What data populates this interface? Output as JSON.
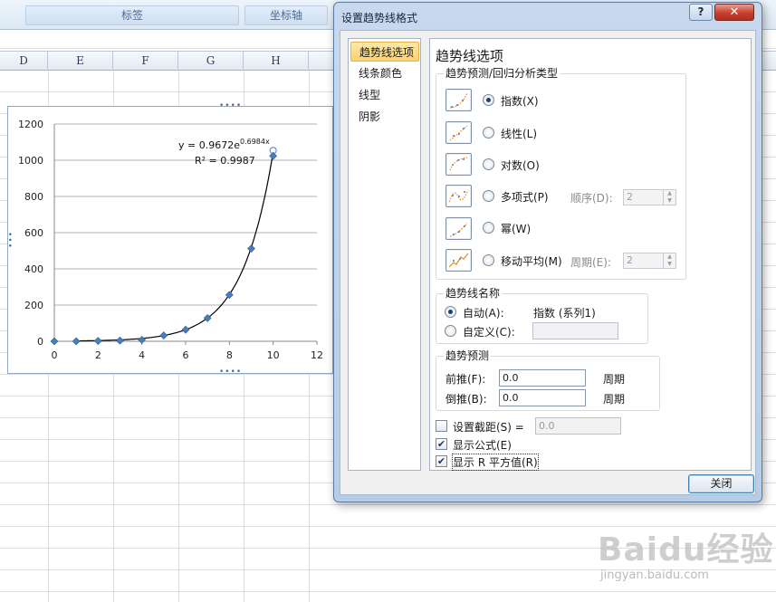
{
  "ribbon": {
    "labels_group": "标签",
    "axes_group": "坐标轴"
  },
  "columns": [
    "D",
    "E",
    "F",
    "G",
    "H"
  ],
  "chart_data": {
    "type": "scatter",
    "x": [
      0,
      1,
      2,
      3,
      4,
      5,
      6,
      7,
      8,
      9,
      10
    ],
    "series": [
      {
        "values": [
          0,
          0,
          2,
          4,
          8,
          32,
          64,
          128,
          256,
          512,
          1024
        ]
      }
    ],
    "trendline": {
      "type": "exponential",
      "a": 0.9672,
      "b": 0.6984,
      "equation_prefix": "y = 0.9672e",
      "equation_exponent": "0.6984x",
      "r2_label": "R² = 0.9987"
    },
    "xlim": [
      0,
      12
    ],
    "ylim": [
      0,
      1200
    ],
    "x_ticks": [
      "0",
      "2",
      "4",
      "6",
      "8",
      "10",
      "12"
    ],
    "y_ticks": [
      "0",
      "200",
      "400",
      "600",
      "800",
      "1000",
      "1200"
    ],
    "grid": true,
    "colors": {
      "marker": "#4a7ebb",
      "trend": "#000000",
      "grid": "#b0b0b0"
    }
  },
  "dialog": {
    "title": "设置趋势线格式",
    "help": "?",
    "close_x": "✕",
    "nav": [
      "趋势线选项",
      "线条颜色",
      "线型",
      "阴影"
    ],
    "section_title": "趋势线选项",
    "regression_group": "趋势预测/回归分析类型",
    "types": [
      {
        "label": "指数(X)",
        "icon": "exponential-trend-icon"
      },
      {
        "label": "线性(L)",
        "icon": "linear-trend-icon"
      },
      {
        "label": "对数(O)",
        "icon": "logarithmic-trend-icon"
      },
      {
        "label": "多项式(P)",
        "icon": "polynomial-trend-icon"
      },
      {
        "label": "幂(W)",
        "icon": "power-trend-icon"
      },
      {
        "label": "移动平均(M)",
        "icon": "moving-average-trend-icon"
      }
    ],
    "order_label": "顺序(D):",
    "order_value": "2",
    "period_label": "周期(E):",
    "period_value": "2",
    "name_group": "趋势线名称",
    "auto_label": "自动(A):",
    "auto_value": "指数 (系列1)",
    "custom_label": "自定义(C):",
    "custom_value": "",
    "forecast_group": "趋势预测",
    "forward_label": "前推(F):",
    "forward_value": "0.0",
    "forward_unit": "周期",
    "backward_label": "倒推(B):",
    "backward_value": "0.0",
    "backward_unit": "周期",
    "intercept_label": "设置截距(S) =",
    "intercept_value": "0.0",
    "show_equation_label": "显示公式(E)",
    "show_r2_label": "显示 R 平方值(R)",
    "close_button": "关闭"
  },
  "watermark": {
    "brand": "Baidu经验",
    "url": "jingyan.baidu.com"
  }
}
